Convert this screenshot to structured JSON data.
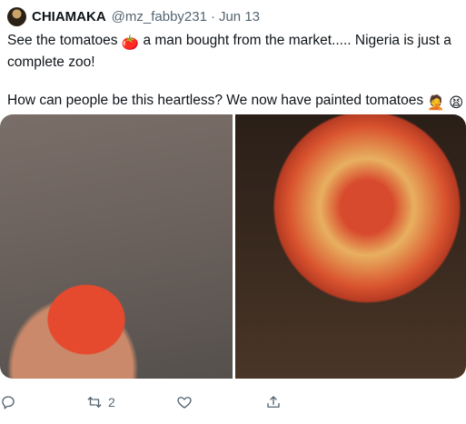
{
  "tweet": {
    "author_name": "CHIAMAKA",
    "handle": "@mz_fabby231",
    "separator": "·",
    "time": "Jun 13",
    "text_line1_before": "See the tomatoes",
    "text_line1_after": " a man bought from the market..... Nigeria is just a",
    "text_line2": "complete zoo!",
    "text_line3": "How can people be this heartless? We now have painted tomatoes",
    "emoji_tomato": "🍅",
    "emoji_facepalm": "🤦",
    "emoji_tired": "😫"
  },
  "media": {
    "left_image": "tomato-in-hand-photo",
    "right_image": "tomato-closeup-photo"
  },
  "actions": {
    "reply_icon": "reply-icon",
    "retweet_icon": "retweet-icon",
    "retweet_count": "2",
    "like_icon": "heart-icon",
    "share_icon": "share-icon"
  },
  "colors": {
    "text": "#0f1419",
    "secondary": "#536471"
  }
}
